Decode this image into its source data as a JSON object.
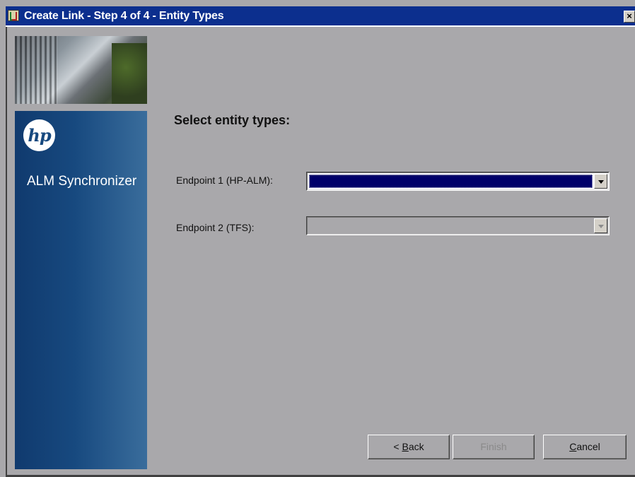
{
  "window": {
    "title": "Create Link - Step 4 of 4 - Entity Types",
    "close_label": "×"
  },
  "sidebar": {
    "logo_text": "hp",
    "product_name": "ALM Synchronizer"
  },
  "main": {
    "heading": "Select entity types:",
    "endpoint1": {
      "label": "Endpoint 1 (HP-ALM):",
      "value": ""
    },
    "endpoint2": {
      "label": "Endpoint 2 (TFS):",
      "value": ""
    }
  },
  "buttons": {
    "back": {
      "prefix": "< ",
      "mnemonic": "B",
      "rest": "ack"
    },
    "finish": {
      "label": "Finish"
    },
    "cancel": {
      "mnemonic": "C",
      "rest": "ancel"
    }
  },
  "colors": {
    "titlebar": "#0c2f8e",
    "dialog_bg": "#a9a8ab",
    "selection": "#00006a",
    "sidebar": "#17497f"
  }
}
